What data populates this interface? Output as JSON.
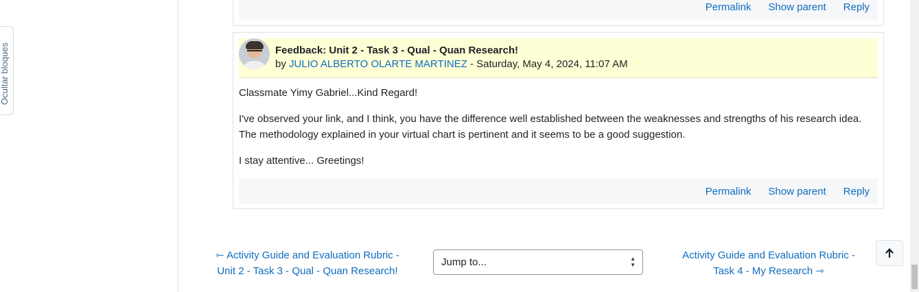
{
  "blocks_tab": {
    "label": "Ocultar bloques"
  },
  "previous_post": {
    "actions": {
      "permalink": "Permalink",
      "show_parent": "Show parent",
      "reply": "Reply"
    }
  },
  "post": {
    "subject": "Feedback: Unit 2 - Task 3 - Qual - Quan Research!",
    "by_label": "by",
    "author": "JULIO ALBERTO OLARTE MARTINEZ",
    "date": "- Saturday, May 4, 2024, 11:07 AM",
    "body": [
      "Classmate Yimy Gabriel...Kind Regard!",
      "I've observed your link, and I think,  you have the difference well established between the weaknesses and strengths of his research idea. The methodology explained in your virtual chart is pertinent and it seems to be a good suggestion.",
      "I stay attentive... Greetings!"
    ],
    "actions": {
      "permalink": "Permalink",
      "show_parent": "Show parent",
      "reply": "Reply"
    }
  },
  "navigation": {
    "previous": {
      "arrow": "⇽",
      "line1": "Activity Guide and Evaluation Rubric -",
      "line2": "Unit 2 - Task 3 - Qual - Quan Research!"
    },
    "jump": {
      "label": "Jump to..."
    },
    "next": {
      "arrow": "⇾",
      "line1": "Activity Guide and Evaluation Rubric  -",
      "line2": "Task 4  - My Research"
    }
  },
  "colors": {
    "link": "#0f6cbf",
    "header_bg": "#ffffd6",
    "actions_bg": "#f6f7f9"
  },
  "icons": {
    "back_to_top": "arrow-up-icon",
    "select_caret": "chevron-updown-icon"
  }
}
